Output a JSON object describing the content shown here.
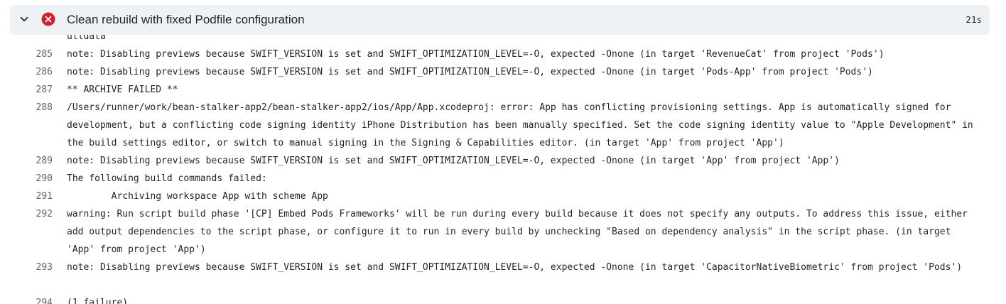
{
  "step": {
    "title": "Clean rebuild with fixed Podfile configuration",
    "duration": "21s",
    "status": "failed",
    "expanded": true,
    "status_color": "#cf222e",
    "chevron_icon": "chevron-down-icon",
    "status_icon": "x-circle-fill-icon"
  },
  "log": {
    "partial_top_text": "ulldata",
    "lines": [
      {
        "num": "285",
        "text": "note: Disabling previews because SWIFT_VERSION is set and SWIFT_OPTIMIZATION_LEVEL=-O, expected -Onone (in target 'RevenueCat' from project 'Pods')"
      },
      {
        "num": "286",
        "text": "note: Disabling previews because SWIFT_VERSION is set and SWIFT_OPTIMIZATION_LEVEL=-O, expected -Onone (in target 'Pods-App' from project 'Pods')"
      },
      {
        "num": "287",
        "text": "** ARCHIVE FAILED **"
      },
      {
        "num": "288",
        "text": "/Users/runner/work/bean-stalker-app2/bean-stalker-app2/ios/App/App.xcodeproj: error: App has conflicting provisioning settings. App is automatically signed for development, but a conflicting code signing identity iPhone Distribution has been manually specified. Set the code signing identity value to \"Apple Development\" in the build settings editor, or switch to manual signing in the Signing & Capabilities editor. (in target 'App' from project 'App')"
      },
      {
        "num": "289",
        "text": "note: Disabling previews because SWIFT_VERSION is set and SWIFT_OPTIMIZATION_LEVEL=-O, expected -Onone (in target 'App' from project 'App')"
      },
      {
        "num": "290",
        "text": "The following build commands failed:"
      },
      {
        "num": "291",
        "text": "\tArchiving workspace App with scheme App"
      },
      {
        "num": "292",
        "text": "warning: Run script build phase '[CP] Embed Pods Frameworks' will be run during every build because it does not specify any outputs. To address this issue, either add output dependencies to the script phase, or configure it to run in every build by unchecking \"Based on dependency analysis\" in the script phase. (in target 'App' from project 'App')"
      },
      {
        "num": "293",
        "text": "note: Disabling previews because SWIFT_VERSION is set and SWIFT_OPTIMIZATION_LEVEL=-O, expected -Onone (in target 'CapacitorNativeBiometric' from project 'Pods')"
      },
      {
        "num": "294",
        "text": "(1 failure)"
      }
    ]
  }
}
